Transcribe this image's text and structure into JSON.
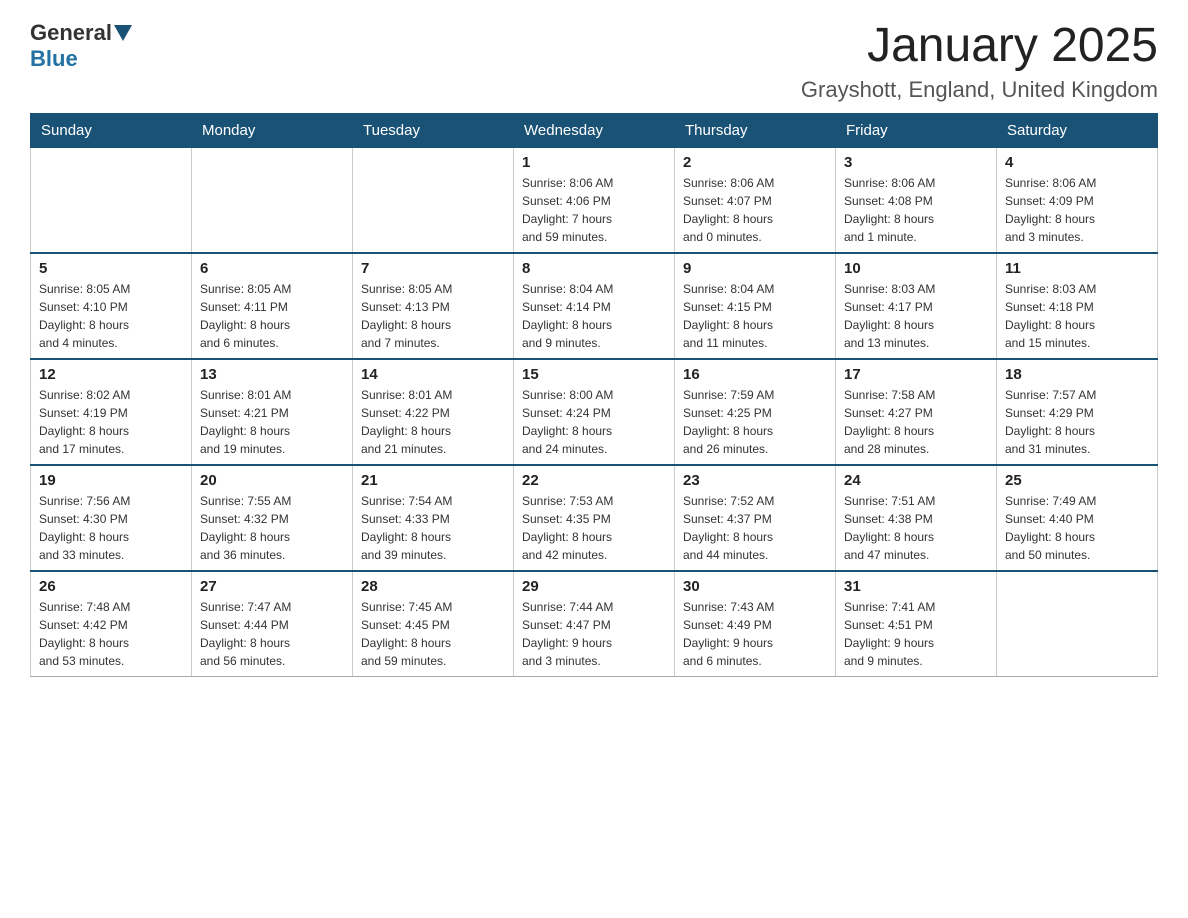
{
  "header": {
    "logo_general": "General",
    "logo_blue": "Blue",
    "title": "January 2025",
    "subtitle": "Grayshott, England, United Kingdom"
  },
  "calendar": {
    "days_of_week": [
      "Sunday",
      "Monday",
      "Tuesday",
      "Wednesday",
      "Thursday",
      "Friday",
      "Saturday"
    ],
    "weeks": [
      {
        "days": [
          {
            "number": "",
            "info": ""
          },
          {
            "number": "",
            "info": ""
          },
          {
            "number": "",
            "info": ""
          },
          {
            "number": "1",
            "info": "Sunrise: 8:06 AM\nSunset: 4:06 PM\nDaylight: 7 hours\nand 59 minutes."
          },
          {
            "number": "2",
            "info": "Sunrise: 8:06 AM\nSunset: 4:07 PM\nDaylight: 8 hours\nand 0 minutes."
          },
          {
            "number": "3",
            "info": "Sunrise: 8:06 AM\nSunset: 4:08 PM\nDaylight: 8 hours\nand 1 minute."
          },
          {
            "number": "4",
            "info": "Sunrise: 8:06 AM\nSunset: 4:09 PM\nDaylight: 8 hours\nand 3 minutes."
          }
        ]
      },
      {
        "days": [
          {
            "number": "5",
            "info": "Sunrise: 8:05 AM\nSunset: 4:10 PM\nDaylight: 8 hours\nand 4 minutes."
          },
          {
            "number": "6",
            "info": "Sunrise: 8:05 AM\nSunset: 4:11 PM\nDaylight: 8 hours\nand 6 minutes."
          },
          {
            "number": "7",
            "info": "Sunrise: 8:05 AM\nSunset: 4:13 PM\nDaylight: 8 hours\nand 7 minutes."
          },
          {
            "number": "8",
            "info": "Sunrise: 8:04 AM\nSunset: 4:14 PM\nDaylight: 8 hours\nand 9 minutes."
          },
          {
            "number": "9",
            "info": "Sunrise: 8:04 AM\nSunset: 4:15 PM\nDaylight: 8 hours\nand 11 minutes."
          },
          {
            "number": "10",
            "info": "Sunrise: 8:03 AM\nSunset: 4:17 PM\nDaylight: 8 hours\nand 13 minutes."
          },
          {
            "number": "11",
            "info": "Sunrise: 8:03 AM\nSunset: 4:18 PM\nDaylight: 8 hours\nand 15 minutes."
          }
        ]
      },
      {
        "days": [
          {
            "number": "12",
            "info": "Sunrise: 8:02 AM\nSunset: 4:19 PM\nDaylight: 8 hours\nand 17 minutes."
          },
          {
            "number": "13",
            "info": "Sunrise: 8:01 AM\nSunset: 4:21 PM\nDaylight: 8 hours\nand 19 minutes."
          },
          {
            "number": "14",
            "info": "Sunrise: 8:01 AM\nSunset: 4:22 PM\nDaylight: 8 hours\nand 21 minutes."
          },
          {
            "number": "15",
            "info": "Sunrise: 8:00 AM\nSunset: 4:24 PM\nDaylight: 8 hours\nand 24 minutes."
          },
          {
            "number": "16",
            "info": "Sunrise: 7:59 AM\nSunset: 4:25 PM\nDaylight: 8 hours\nand 26 minutes."
          },
          {
            "number": "17",
            "info": "Sunrise: 7:58 AM\nSunset: 4:27 PM\nDaylight: 8 hours\nand 28 minutes."
          },
          {
            "number": "18",
            "info": "Sunrise: 7:57 AM\nSunset: 4:29 PM\nDaylight: 8 hours\nand 31 minutes."
          }
        ]
      },
      {
        "days": [
          {
            "number": "19",
            "info": "Sunrise: 7:56 AM\nSunset: 4:30 PM\nDaylight: 8 hours\nand 33 minutes."
          },
          {
            "number": "20",
            "info": "Sunrise: 7:55 AM\nSunset: 4:32 PM\nDaylight: 8 hours\nand 36 minutes."
          },
          {
            "number": "21",
            "info": "Sunrise: 7:54 AM\nSunset: 4:33 PM\nDaylight: 8 hours\nand 39 minutes."
          },
          {
            "number": "22",
            "info": "Sunrise: 7:53 AM\nSunset: 4:35 PM\nDaylight: 8 hours\nand 42 minutes."
          },
          {
            "number": "23",
            "info": "Sunrise: 7:52 AM\nSunset: 4:37 PM\nDaylight: 8 hours\nand 44 minutes."
          },
          {
            "number": "24",
            "info": "Sunrise: 7:51 AM\nSunset: 4:38 PM\nDaylight: 8 hours\nand 47 minutes."
          },
          {
            "number": "25",
            "info": "Sunrise: 7:49 AM\nSunset: 4:40 PM\nDaylight: 8 hours\nand 50 minutes."
          }
        ]
      },
      {
        "days": [
          {
            "number": "26",
            "info": "Sunrise: 7:48 AM\nSunset: 4:42 PM\nDaylight: 8 hours\nand 53 minutes."
          },
          {
            "number": "27",
            "info": "Sunrise: 7:47 AM\nSunset: 4:44 PM\nDaylight: 8 hours\nand 56 minutes."
          },
          {
            "number": "28",
            "info": "Sunrise: 7:45 AM\nSunset: 4:45 PM\nDaylight: 8 hours\nand 59 minutes."
          },
          {
            "number": "29",
            "info": "Sunrise: 7:44 AM\nSunset: 4:47 PM\nDaylight: 9 hours\nand 3 minutes."
          },
          {
            "number": "30",
            "info": "Sunrise: 7:43 AM\nSunset: 4:49 PM\nDaylight: 9 hours\nand 6 minutes."
          },
          {
            "number": "31",
            "info": "Sunrise: 7:41 AM\nSunset: 4:51 PM\nDaylight: 9 hours\nand 9 minutes."
          },
          {
            "number": "",
            "info": ""
          }
        ]
      }
    ]
  }
}
